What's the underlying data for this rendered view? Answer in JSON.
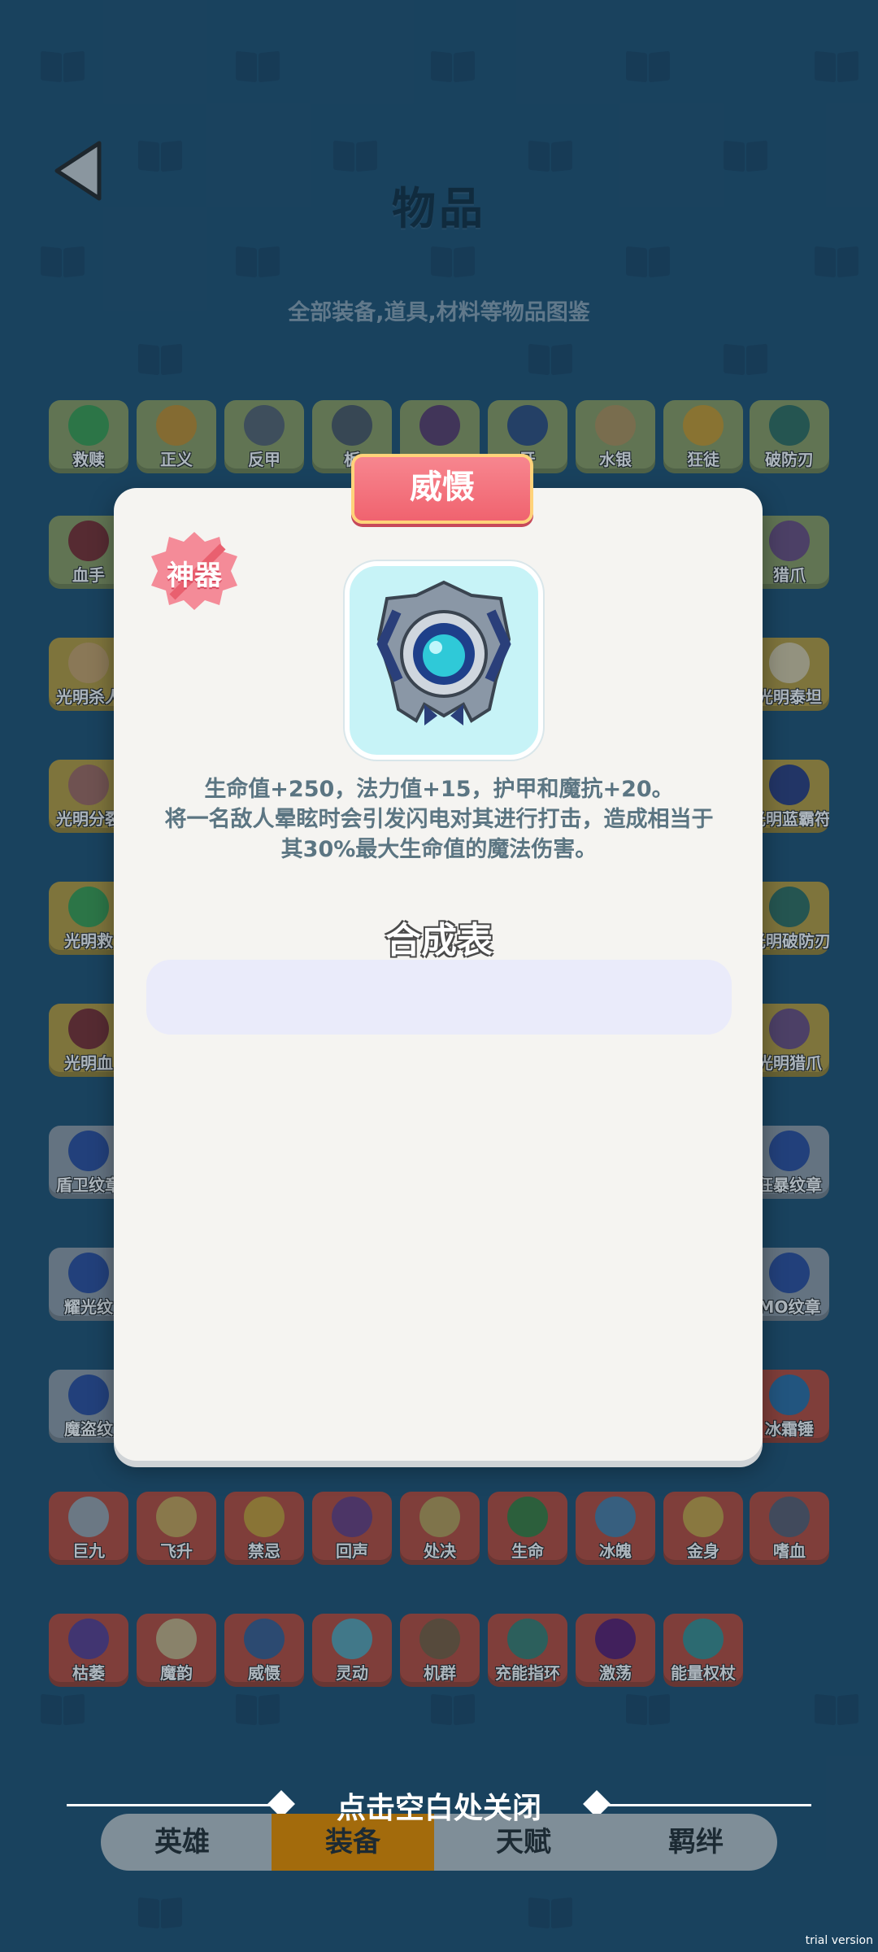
{
  "page": {
    "title": "物品",
    "subtitle": "全部装备,道具,材料等物品图鉴",
    "back_icon": "back-arrow-icon"
  },
  "grid": {
    "row1": [
      "救赎",
      "正义",
      "反甲",
      "板",
      "",
      "牙",
      "水银",
      "狂徒",
      "破防刃"
    ],
    "row2_left": "血手",
    "row2_right": "猎爪",
    "row3_left": "光明杀人",
    "row3_right": "光明泰坦",
    "row4_left": "光明分裂",
    "row4_right": "光明蓝霸符",
    "row5_left": "光明救",
    "row5_right": "光明破防刃",
    "row6_left": "光明血",
    "row6_right": "光明猎爪",
    "row7_left": "盾卫纹章",
    "row7_right": "狂暴纹章",
    "row8_left": "耀光纹",
    "row8_right": "MO纹章",
    "row9_left": "魔盗纹",
    "row9_right": "冰霜锤",
    "row10": [
      "巨九",
      "飞升",
      "禁忌",
      "回声",
      "处决",
      "生命",
      "冰魄",
      "金身",
      "嗜血"
    ],
    "row11": [
      "枯萎",
      "魔韵",
      "威慑",
      "灵动",
      "机群",
      "充能指环",
      "激荡",
      "能量权杖"
    ]
  },
  "modal": {
    "item_name": "威慑",
    "rarity": "神器",
    "description_line1": "生命值+250，法力值+15，护甲和魔抗+20。",
    "description_line2": "将一名敌人晕眩时会引发闪电对其进行打击，造成相当于",
    "description_line3": "其30%最大生命值的魔法伤害。",
    "recipe_title": "合成表",
    "item_icon": "artifact-shield-orb-icon"
  },
  "close_hint": "点击空白处关闭",
  "tabs": [
    "英雄",
    "装备",
    "天赋",
    "羁绊"
  ],
  "active_tab": "装备",
  "watermark": "trial version",
  "colors": {
    "background": "#1d4d6e",
    "ribbon": "#f0636f",
    "rarity_badge": "#f37b8b",
    "item_frame": "#c7f3f7",
    "active_tab": "#a36b0c"
  }
}
